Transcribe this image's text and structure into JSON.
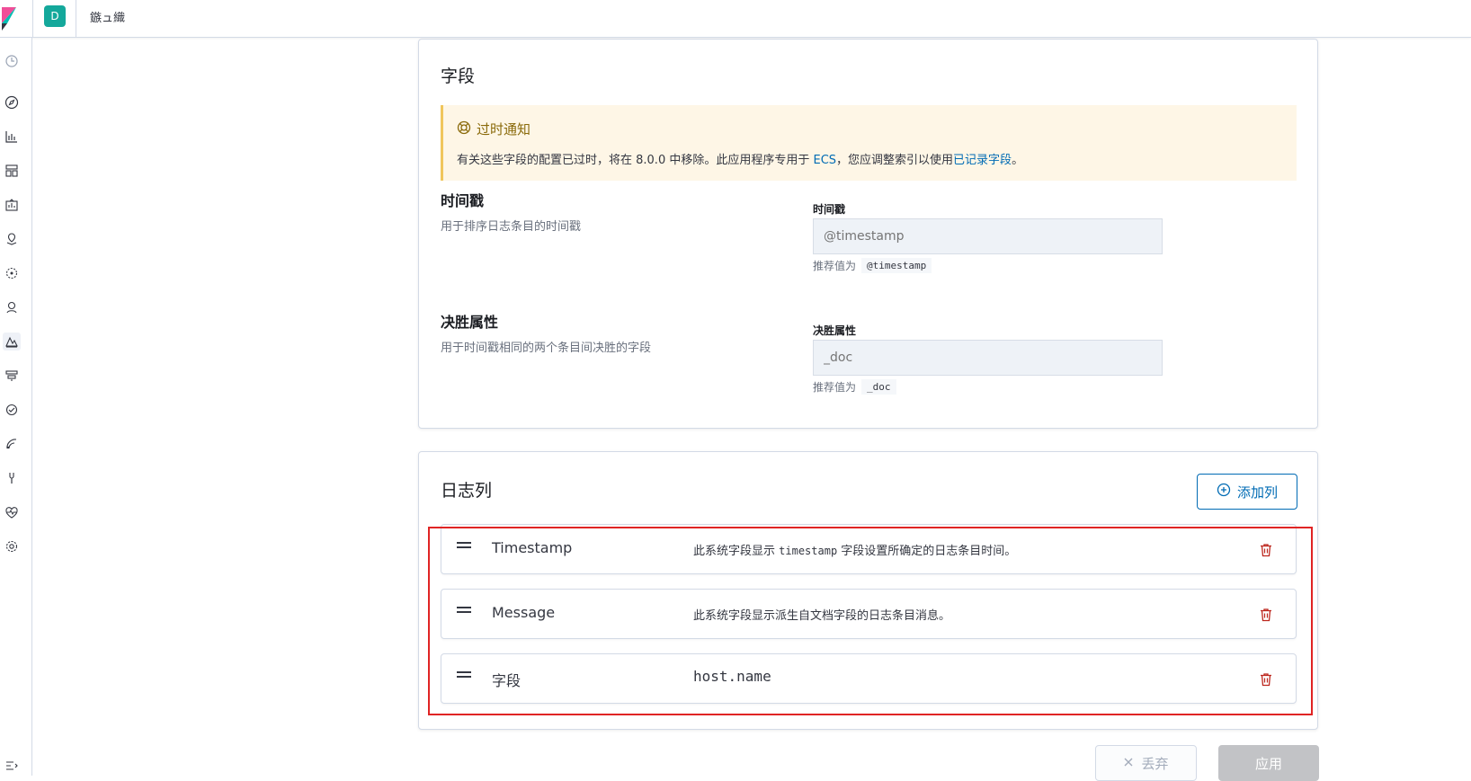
{
  "topbar": {
    "space_initial": "D",
    "breadcrumb": "鏃ュ織"
  },
  "fields_panel": {
    "title": "字段",
    "callout": {
      "title": "过时通知",
      "body_prefix": "有关这些字段的配置已过时，将在 8.0.0 中移除。此应用程序专用于 ",
      "link_ecs": "ECS",
      "body_middle": "，您应调整索引以使用",
      "link_documented": "已记录字段",
      "body_suffix": "。"
    },
    "timestamp": {
      "title": "时间戳",
      "description": "用于排序日志条目的时间戳",
      "label": "时间戳",
      "placeholder": "@timestamp",
      "help_prefix": "推荐值为",
      "help_code": "@timestamp"
    },
    "tiebreaker": {
      "title": "决胜属性",
      "description": "用于时间戳相同的两个条目间决胜的字段",
      "label": "决胜属性",
      "placeholder": "_doc",
      "help_prefix": "推荐值为",
      "help_code": "_doc"
    }
  },
  "log_columns_panel": {
    "title": "日志列",
    "add_column_label": "添加列",
    "rows": [
      {
        "name": "Timestamp",
        "desc_prefix": "此系统字段显示 ",
        "desc_code": "timestamp",
        "desc_suffix": " 字段设置所确定的日志条目时间。"
      },
      {
        "name": "Message",
        "description": "此系统字段显示派生自文档字段的日志条目消息。"
      },
      {
        "name": "字段",
        "value": "host.name"
      }
    ]
  },
  "footer": {
    "discard_label": "丢弃",
    "apply_label": "应用"
  },
  "colors": {
    "accent": "#006bb4",
    "warning_bg": "#fef6e6",
    "warning_text": "#8a6a0a",
    "danger": "#bd271e",
    "highlight": "#e02424"
  }
}
